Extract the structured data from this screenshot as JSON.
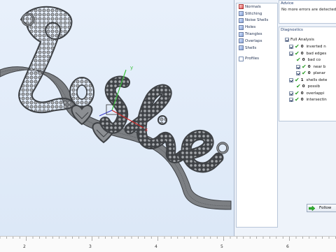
{
  "panel": {
    "tree": {
      "items": [
        {
          "label": "Normals",
          "icon": "normals-icon"
        },
        {
          "label": "Stitching",
          "icon": "stitching-icon"
        },
        {
          "label": "Noise Shells",
          "icon": "noise-shells-icon"
        },
        {
          "label": "Holes",
          "icon": "holes-icon"
        },
        {
          "label": "Triangles",
          "icon": "triangles-icon"
        },
        {
          "label": "Overlaps",
          "icon": "overlaps-icon"
        },
        {
          "label": "Shells",
          "icon": "shells-icon"
        }
      ],
      "profiles_label": "Profiles"
    },
    "advice": {
      "title": "Advice",
      "text": "No more errors are detected. It"
    },
    "diagnostics": {
      "title": "Diagnostics",
      "full_analysis_label": "Full Analysis",
      "rows": [
        {
          "count": "0",
          "label": "inverted n",
          "checkbox": true
        },
        {
          "count": "0",
          "label": "bad edges",
          "checkbox": true
        },
        {
          "count": "0",
          "label": "bad co",
          "checkbox": false
        },
        {
          "count": "0",
          "label": "near b",
          "checkbox": true
        },
        {
          "count": "0",
          "label": "planar",
          "checkbox": true
        },
        {
          "count": "1",
          "label": "shells dete",
          "checkbox": true
        },
        {
          "count": "0",
          "label": "possib",
          "checkbox": false
        },
        {
          "count": "0",
          "label": "overlappi",
          "checkbox": true
        },
        {
          "count": "0",
          "label": "intersectin",
          "checkbox": true
        }
      ]
    },
    "follow_label": "Follow"
  },
  "ruler": {
    "ticks": [
      "2",
      "3",
      "4",
      "5",
      "6"
    ]
  },
  "axis": {
    "y_label": "y",
    "x_label": "x"
  },
  "colors": {
    "model": "#8c8f93",
    "x_axis": "#d02424",
    "y_axis": "#3cc23c",
    "check": "#2a9d25"
  }
}
